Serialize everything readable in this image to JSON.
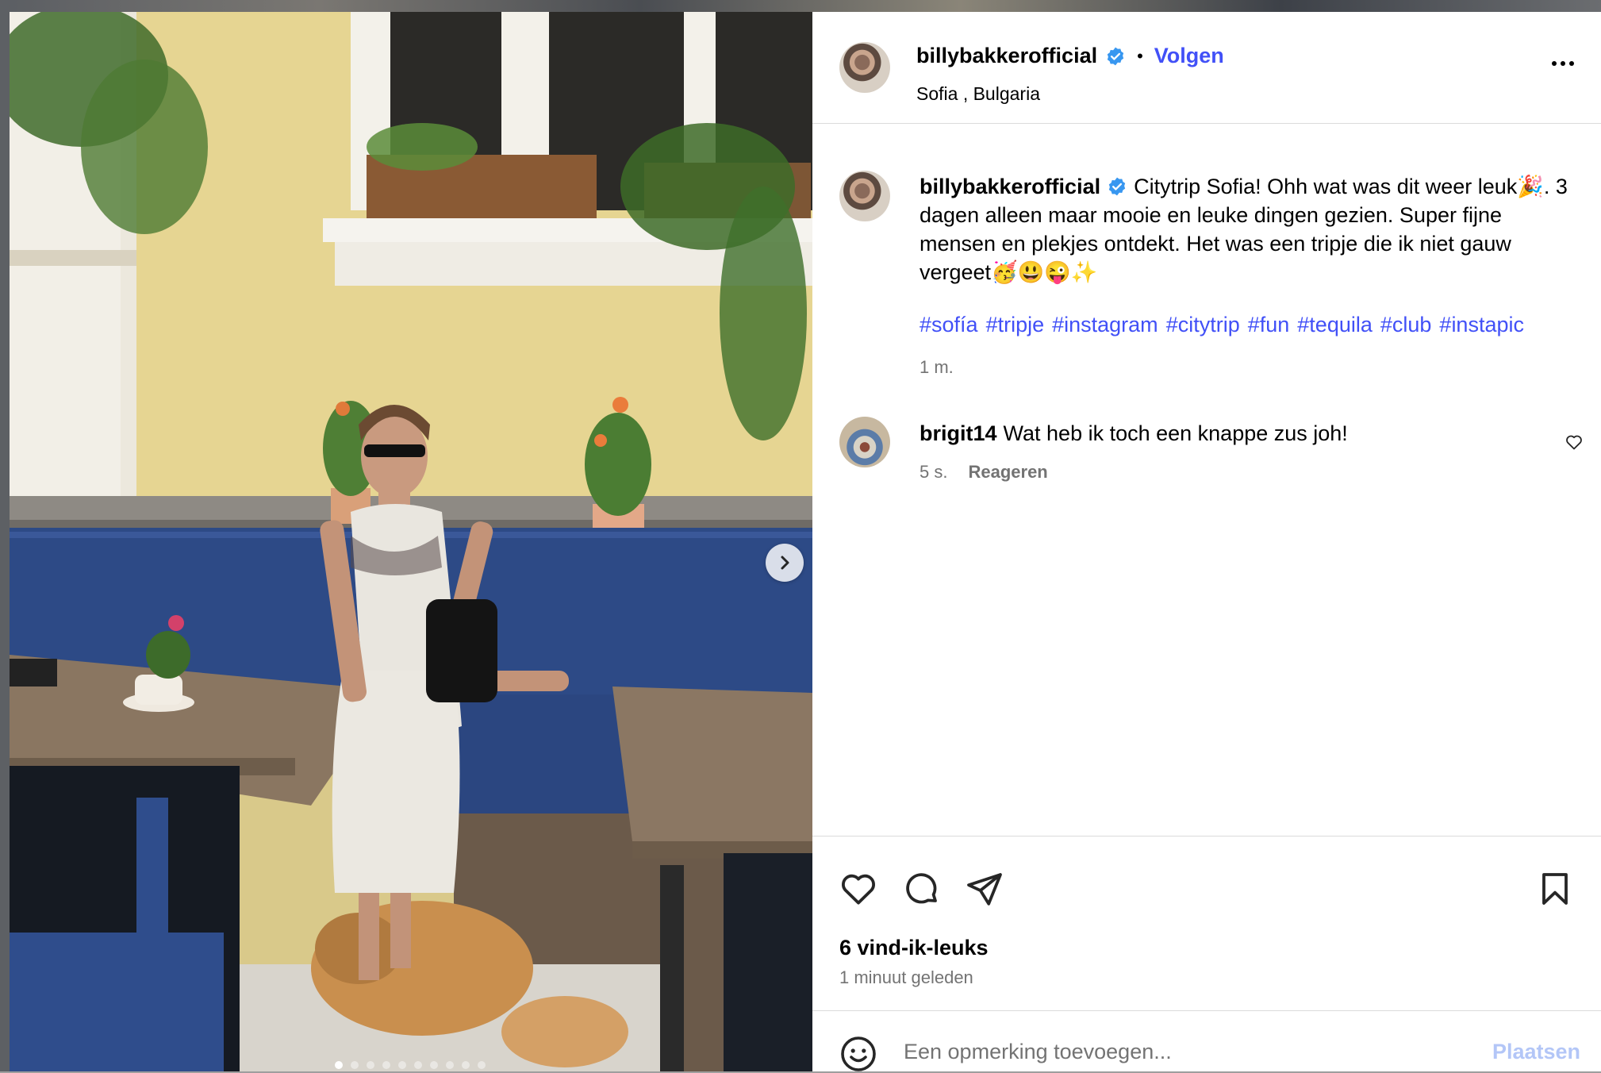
{
  "colors": {
    "accent_blue": "#4150f7",
    "verified_blue": "#3897f0",
    "muted_text": "#737373",
    "post_button_disabled": "#b3c6f7"
  },
  "photo": {
    "description_icon": "photo",
    "carousel_next_icon": "chevron-right-icon",
    "carousel_slide_count": 10,
    "carousel_active_index": 0
  },
  "header": {
    "username": "billybakkerofficial",
    "separator": "•",
    "follow_label": "Volgen",
    "location": "Sofia , Bulgaria",
    "more_icon": "more-horizontal-icon"
  },
  "caption": {
    "username": "billybakkerofficial",
    "text": "Citytrip Sofia! Ohh wat was dit weer leuk🎉. 3 dagen alleen maar mooie en leuke dingen gezien. Super fijne mensen en plekjes ontdekt. Het was een tripje die ik niet gauw vergeet🥳😃😜✨",
    "hashtags": [
      "#sofía",
      "#tripje",
      "#instagram",
      "#citytrip",
      "#fun",
      "#tequila",
      "#club",
      "#instapic"
    ],
    "time": "1 m."
  },
  "comments": [
    {
      "username": "brigit14",
      "text": "Wat heb ik toch een knappe zus joh!",
      "time": "5 s.",
      "reply_label": "Reageren"
    }
  ],
  "actions": {
    "like_icon": "heart-icon",
    "comment_icon": "speech-bubble-icon",
    "share_icon": "paper-plane-icon",
    "save_icon": "bookmark-icon"
  },
  "likes_label": "6 vind-ik-leuks",
  "posted_label": "1 minuut geleden",
  "add_comment": {
    "emoji_icon": "smiley-icon",
    "placeholder": "Een opmerking toevoegen...",
    "post_label": "Plaatsen"
  }
}
